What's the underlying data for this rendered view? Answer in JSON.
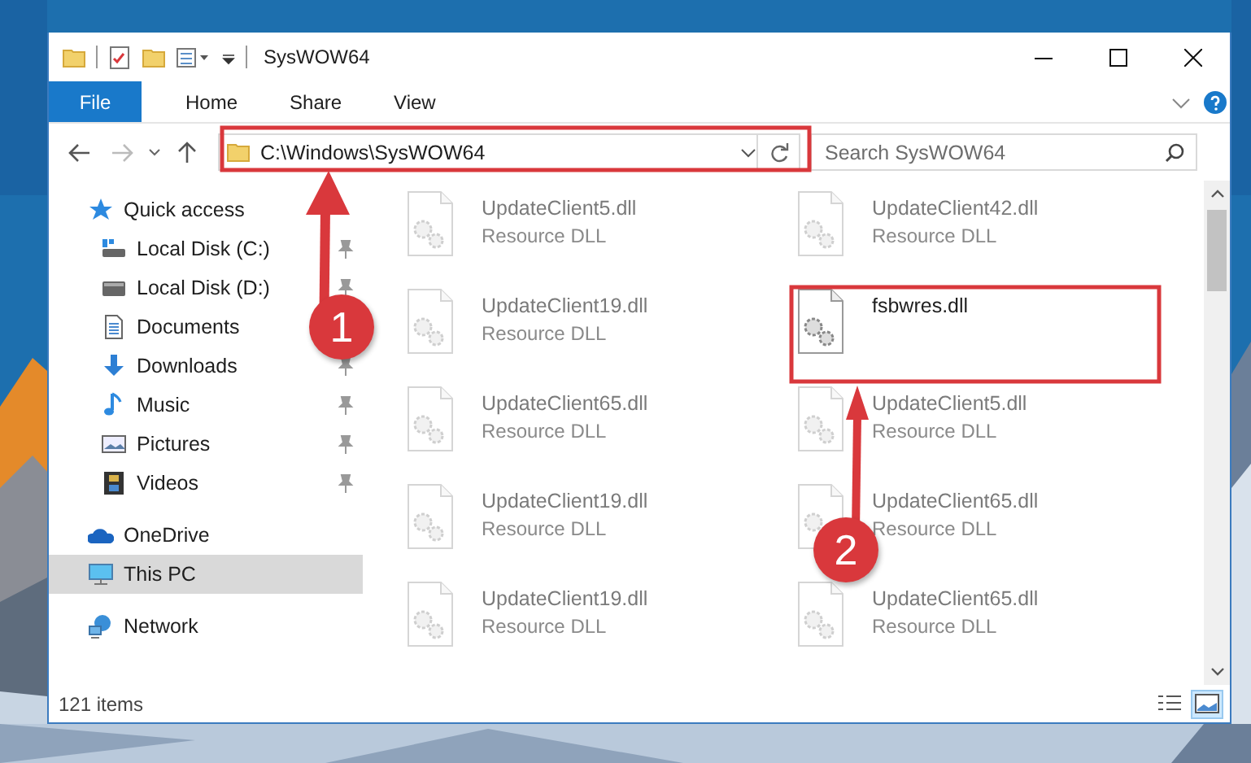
{
  "window": {
    "title": "SysWOW64"
  },
  "ribbon_tabs": [
    {
      "label": "File",
      "kind": "file"
    },
    {
      "label": "Home",
      "kind": "tab"
    },
    {
      "label": "Share",
      "kind": "tab"
    },
    {
      "label": "View",
      "kind": "tab"
    }
  ],
  "address_bar": {
    "value": "C:\\Windows\\SysWOW64"
  },
  "search": {
    "placeholder": "Search SysWOW64"
  },
  "sidebar": {
    "items": [
      {
        "label": "Quick access",
        "selected": false,
        "children": [
          {
            "label": "Local Disk (C:)",
            "pinned": true,
            "selected": false
          },
          {
            "label": "Local Disk (D:)",
            "pinned": true,
            "selected": false
          },
          {
            "label": "Documents",
            "pinned": false,
            "selected": false
          },
          {
            "label": "Downloads",
            "pinned": true,
            "selected": false
          },
          {
            "label": "Music",
            "pinned": true,
            "selected": false
          },
          {
            "label": "Pictures",
            "pinned": true,
            "selected": false
          },
          {
            "label": "Videos",
            "pinned": true,
            "selected": false
          }
        ]
      },
      {
        "label": "OneDrive",
        "selected": false
      },
      {
        "label": "This PC",
        "selected": true
      },
      {
        "label": "Network",
        "selected": false
      }
    ]
  },
  "files": [
    {
      "name": "UpdateClient5.dll",
      "type": "Resource DLL",
      "blurred": true
    },
    {
      "name": "UpdateClient42.dll",
      "type": "Resource DLL",
      "blurred": true
    },
    {
      "name": "UpdateClient19.dll",
      "type": "Resource DLL",
      "blurred": true
    },
    {
      "name": "fsbwres.dll",
      "blurred": false
    },
    {
      "name": "UpdateClient65.dll",
      "type": "Resource DLL",
      "blurred": true
    },
    {
      "name": "UpdateClient5.dll",
      "type": "Resource DLL",
      "blurred": true
    },
    {
      "name": "UpdateClient19.dll",
      "type": "Resource DLL",
      "blurred": true
    },
    {
      "name": "UpdateClient65.dll",
      "type": "Resource DLL",
      "blurred": true
    },
    {
      "name": "UpdateClient19.dll",
      "type": "Resource DLL",
      "blurred": true
    },
    {
      "name": "UpdateClient65.dll",
      "type": "Resource DLL",
      "blurred": true
    }
  ],
  "status_bar": {
    "item_count": "121 items",
    "views": [
      {
        "selected": false
      },
      {
        "selected": true
      }
    ]
  },
  "callouts": [
    {
      "number": "1"
    },
    {
      "number": "2"
    }
  ]
}
